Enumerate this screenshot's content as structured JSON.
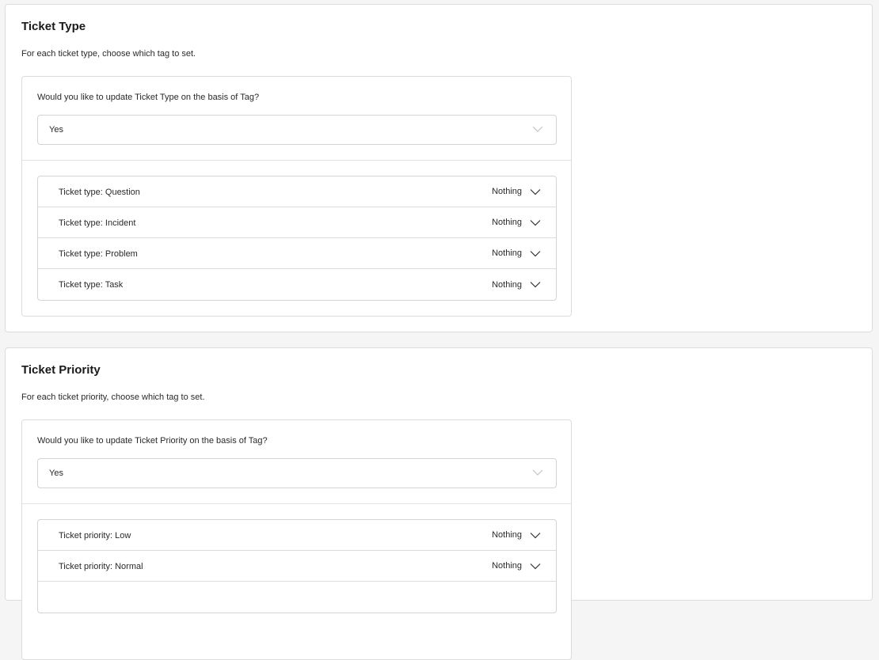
{
  "sections": [
    {
      "title": "Ticket Type",
      "description": "For each ticket type, choose which tag to set.",
      "question": "Would you like to update Ticket Type on the basis of Tag?",
      "select_value": "Yes",
      "rows": [
        {
          "label": "Ticket type: Question",
          "value": "Nothing"
        },
        {
          "label": "Ticket type: Incident",
          "value": "Nothing"
        },
        {
          "label": "Ticket type: Problem",
          "value": "Nothing"
        },
        {
          "label": "Ticket type: Task",
          "value": "Nothing"
        }
      ]
    },
    {
      "title": "Ticket Priority",
      "description": "For each ticket priority, choose which tag to set.",
      "question": "Would you like to update Ticket Priority on the basis of Tag?",
      "select_value": "Yes",
      "rows": [
        {
          "label": "Ticket priority: Low",
          "value": "Nothing"
        },
        {
          "label": "Ticket priority: Normal",
          "value": "Nothing"
        },
        {
          "label": "",
          "value": ""
        }
      ]
    }
  ],
  "icons": {
    "select_chevron": "chevron-down-icon",
    "row_chevron": "chevron-down-icon"
  },
  "colors": {
    "border": "#dcdcdc",
    "page_bg": "#f5f5f5",
    "select_chevron": "#c4c4c4",
    "row_chevron": "#333333"
  }
}
